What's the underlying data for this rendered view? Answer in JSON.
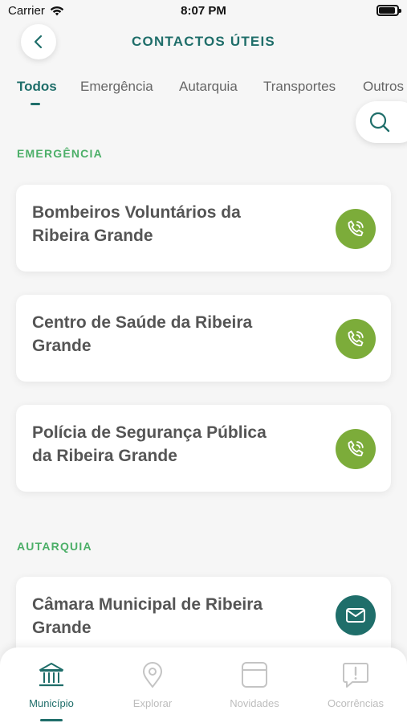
{
  "status_bar": {
    "carrier": "Carrier",
    "time": "8:07 PM",
    "battery_level": 0.9
  },
  "header": {
    "title": "CONTACTOS ÚTEIS",
    "back_icon": "chevron-left-icon"
  },
  "tabs": [
    {
      "label": "Todos",
      "active": true
    },
    {
      "label": "Emergência",
      "active": false
    },
    {
      "label": "Autarquia",
      "active": false
    },
    {
      "label": "Transportes",
      "active": false
    },
    {
      "label": "Outros",
      "active": false
    }
  ],
  "search": {
    "icon": "search-icon"
  },
  "sections": [
    {
      "title": "EMERGÊNCIA",
      "contacts": [
        {
          "name": "Bombeiros Voluntários da Ribeira Grande",
          "action": "call",
          "icon": "phone-icon"
        },
        {
          "name": "Centro de Saúde da Ribeira Grande",
          "action": "call",
          "icon": "phone-icon"
        },
        {
          "name": "Polícia de Segurança Pública da Ribeira Grande",
          "action": "call",
          "icon": "phone-icon"
        }
      ]
    },
    {
      "title": "AUTARQUIA",
      "contacts": [
        {
          "name": "Câmara Municipal de Ribeira Grande",
          "action": "mail",
          "icon": "mail-icon"
        }
      ]
    }
  ],
  "bottom_nav": [
    {
      "label": "Município",
      "icon": "municipality-icon",
      "active": true
    },
    {
      "label": "Explorar",
      "icon": "location-pin-icon",
      "active": false
    },
    {
      "label": "Novidades",
      "icon": "news-icon",
      "active": false
    },
    {
      "label": "Ocorrências",
      "icon": "alert-icon",
      "active": false
    }
  ],
  "colors": {
    "primary": "#1f6e6a",
    "call": "#7cac3a",
    "section": "#4caf68",
    "inactive": "#bdbdbd"
  }
}
